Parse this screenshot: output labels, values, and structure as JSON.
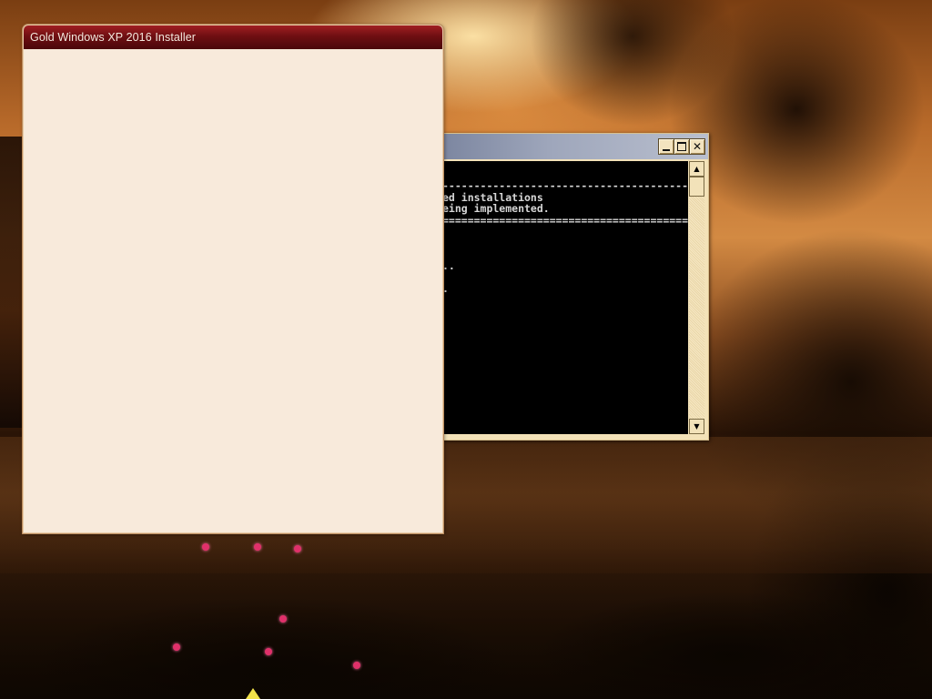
{
  "installer": {
    "title": "Gold Windows XP 2016 Installer"
  },
  "console": {
    "lines": [
      "----------------------------------------",
      "ed installations",
      "eing implemented.",
      "========================================",
      "",
      "",
      "",
      "..",
      "",
      "."
    ],
    "buttons": {
      "minimize": "minimize",
      "maximize": "maximize",
      "close": "✕"
    },
    "scrollbar": {
      "up": "▲",
      "down": "▼"
    }
  },
  "colors": {
    "installer_titlebar": "#7a0f12",
    "installer_body": "#f8eadb",
    "console_background": "#000000",
    "console_text": "#d7d7d7",
    "console_frame": "#f3e2b8"
  },
  "icons": [
    "minimize-icon",
    "maximize-icon",
    "close-icon",
    "scroll-up-icon",
    "scroll-down-icon"
  ]
}
